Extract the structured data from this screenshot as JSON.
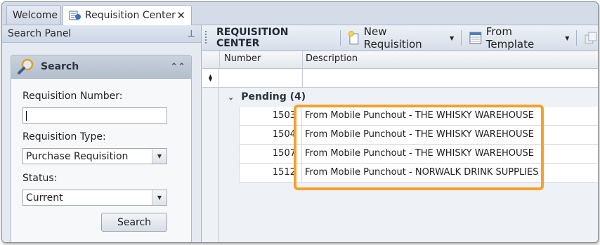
{
  "tabs": [
    {
      "label": "Welcome"
    },
    {
      "label": "Requisition Center",
      "icon": "requisition-doc-icon"
    }
  ],
  "search_panel": {
    "title": "Search Panel",
    "group_title": "Search",
    "requisition_number_label": "Requisition Number:",
    "requisition_number_value": "",
    "requisition_type_label": "Requisition Type:",
    "requisition_type_value": "Purchase Requisition",
    "status_label": "Status:",
    "status_value": "Current",
    "search_button": "Search"
  },
  "toolbar": {
    "title": "REQUISITION CENTER",
    "new_requisition": "New Requisition",
    "from_template": "From Template"
  },
  "grid": {
    "columns": [
      "Number",
      "Description"
    ],
    "group_label": "Pending (4)",
    "rows": [
      {
        "number": "1503",
        "description": "From Mobile Punchout - THE WHISKY WAREHOUSE"
      },
      {
        "number": "1504",
        "description": "From Mobile Punchout - THE WHISKY WAREHOUSE"
      },
      {
        "number": "1507",
        "description": "From Mobile Punchout - THE WHISKY WAREHOUSE"
      },
      {
        "number": "1512",
        "description": "From Mobile Punchout - NORWALK DRINK SUPPLIES"
      }
    ]
  },
  "colors": {
    "highlight": "#f5a12b",
    "tab_strip": "#d4dcea"
  }
}
